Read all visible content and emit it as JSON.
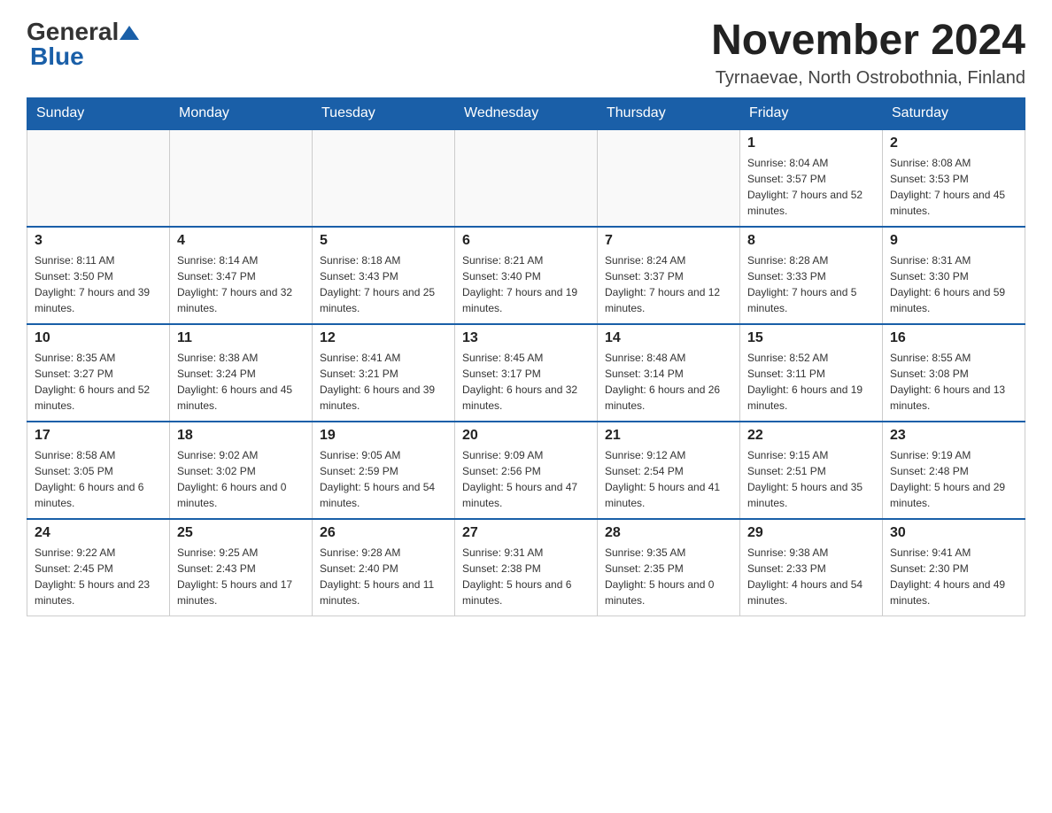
{
  "header": {
    "logo_general": "General",
    "logo_blue": "Blue",
    "month_title": "November 2024",
    "location": "Tyrnaevae, North Ostrobothnia, Finland"
  },
  "weekdays": [
    "Sunday",
    "Monday",
    "Tuesday",
    "Wednesday",
    "Thursday",
    "Friday",
    "Saturday"
  ],
  "weeks": [
    [
      {
        "day": "",
        "sunrise": "",
        "sunset": "",
        "daylight": ""
      },
      {
        "day": "",
        "sunrise": "",
        "sunset": "",
        "daylight": ""
      },
      {
        "day": "",
        "sunrise": "",
        "sunset": "",
        "daylight": ""
      },
      {
        "day": "",
        "sunrise": "",
        "sunset": "",
        "daylight": ""
      },
      {
        "day": "",
        "sunrise": "",
        "sunset": "",
        "daylight": ""
      },
      {
        "day": "1",
        "sunrise": "Sunrise: 8:04 AM",
        "sunset": "Sunset: 3:57 PM",
        "daylight": "Daylight: 7 hours and 52 minutes."
      },
      {
        "day": "2",
        "sunrise": "Sunrise: 8:08 AM",
        "sunset": "Sunset: 3:53 PM",
        "daylight": "Daylight: 7 hours and 45 minutes."
      }
    ],
    [
      {
        "day": "3",
        "sunrise": "Sunrise: 8:11 AM",
        "sunset": "Sunset: 3:50 PM",
        "daylight": "Daylight: 7 hours and 39 minutes."
      },
      {
        "day": "4",
        "sunrise": "Sunrise: 8:14 AM",
        "sunset": "Sunset: 3:47 PM",
        "daylight": "Daylight: 7 hours and 32 minutes."
      },
      {
        "day": "5",
        "sunrise": "Sunrise: 8:18 AM",
        "sunset": "Sunset: 3:43 PM",
        "daylight": "Daylight: 7 hours and 25 minutes."
      },
      {
        "day": "6",
        "sunrise": "Sunrise: 8:21 AM",
        "sunset": "Sunset: 3:40 PM",
        "daylight": "Daylight: 7 hours and 19 minutes."
      },
      {
        "day": "7",
        "sunrise": "Sunrise: 8:24 AM",
        "sunset": "Sunset: 3:37 PM",
        "daylight": "Daylight: 7 hours and 12 minutes."
      },
      {
        "day": "8",
        "sunrise": "Sunrise: 8:28 AM",
        "sunset": "Sunset: 3:33 PM",
        "daylight": "Daylight: 7 hours and 5 minutes."
      },
      {
        "day": "9",
        "sunrise": "Sunrise: 8:31 AM",
        "sunset": "Sunset: 3:30 PM",
        "daylight": "Daylight: 6 hours and 59 minutes."
      }
    ],
    [
      {
        "day": "10",
        "sunrise": "Sunrise: 8:35 AM",
        "sunset": "Sunset: 3:27 PM",
        "daylight": "Daylight: 6 hours and 52 minutes."
      },
      {
        "day": "11",
        "sunrise": "Sunrise: 8:38 AM",
        "sunset": "Sunset: 3:24 PM",
        "daylight": "Daylight: 6 hours and 45 minutes."
      },
      {
        "day": "12",
        "sunrise": "Sunrise: 8:41 AM",
        "sunset": "Sunset: 3:21 PM",
        "daylight": "Daylight: 6 hours and 39 minutes."
      },
      {
        "day": "13",
        "sunrise": "Sunrise: 8:45 AM",
        "sunset": "Sunset: 3:17 PM",
        "daylight": "Daylight: 6 hours and 32 minutes."
      },
      {
        "day": "14",
        "sunrise": "Sunrise: 8:48 AM",
        "sunset": "Sunset: 3:14 PM",
        "daylight": "Daylight: 6 hours and 26 minutes."
      },
      {
        "day": "15",
        "sunrise": "Sunrise: 8:52 AM",
        "sunset": "Sunset: 3:11 PM",
        "daylight": "Daylight: 6 hours and 19 minutes."
      },
      {
        "day": "16",
        "sunrise": "Sunrise: 8:55 AM",
        "sunset": "Sunset: 3:08 PM",
        "daylight": "Daylight: 6 hours and 13 minutes."
      }
    ],
    [
      {
        "day": "17",
        "sunrise": "Sunrise: 8:58 AM",
        "sunset": "Sunset: 3:05 PM",
        "daylight": "Daylight: 6 hours and 6 minutes."
      },
      {
        "day": "18",
        "sunrise": "Sunrise: 9:02 AM",
        "sunset": "Sunset: 3:02 PM",
        "daylight": "Daylight: 6 hours and 0 minutes."
      },
      {
        "day": "19",
        "sunrise": "Sunrise: 9:05 AM",
        "sunset": "Sunset: 2:59 PM",
        "daylight": "Daylight: 5 hours and 54 minutes."
      },
      {
        "day": "20",
        "sunrise": "Sunrise: 9:09 AM",
        "sunset": "Sunset: 2:56 PM",
        "daylight": "Daylight: 5 hours and 47 minutes."
      },
      {
        "day": "21",
        "sunrise": "Sunrise: 9:12 AM",
        "sunset": "Sunset: 2:54 PM",
        "daylight": "Daylight: 5 hours and 41 minutes."
      },
      {
        "day": "22",
        "sunrise": "Sunrise: 9:15 AM",
        "sunset": "Sunset: 2:51 PM",
        "daylight": "Daylight: 5 hours and 35 minutes."
      },
      {
        "day": "23",
        "sunrise": "Sunrise: 9:19 AM",
        "sunset": "Sunset: 2:48 PM",
        "daylight": "Daylight: 5 hours and 29 minutes."
      }
    ],
    [
      {
        "day": "24",
        "sunrise": "Sunrise: 9:22 AM",
        "sunset": "Sunset: 2:45 PM",
        "daylight": "Daylight: 5 hours and 23 minutes."
      },
      {
        "day": "25",
        "sunrise": "Sunrise: 9:25 AM",
        "sunset": "Sunset: 2:43 PM",
        "daylight": "Daylight: 5 hours and 17 minutes."
      },
      {
        "day": "26",
        "sunrise": "Sunrise: 9:28 AM",
        "sunset": "Sunset: 2:40 PM",
        "daylight": "Daylight: 5 hours and 11 minutes."
      },
      {
        "day": "27",
        "sunrise": "Sunrise: 9:31 AM",
        "sunset": "Sunset: 2:38 PM",
        "daylight": "Daylight: 5 hours and 6 minutes."
      },
      {
        "day": "28",
        "sunrise": "Sunrise: 9:35 AM",
        "sunset": "Sunset: 2:35 PM",
        "daylight": "Daylight: 5 hours and 0 minutes."
      },
      {
        "day": "29",
        "sunrise": "Sunrise: 9:38 AM",
        "sunset": "Sunset: 2:33 PM",
        "daylight": "Daylight: 4 hours and 54 minutes."
      },
      {
        "day": "30",
        "sunrise": "Sunrise: 9:41 AM",
        "sunset": "Sunset: 2:30 PM",
        "daylight": "Daylight: 4 hours and 49 minutes."
      }
    ]
  ]
}
